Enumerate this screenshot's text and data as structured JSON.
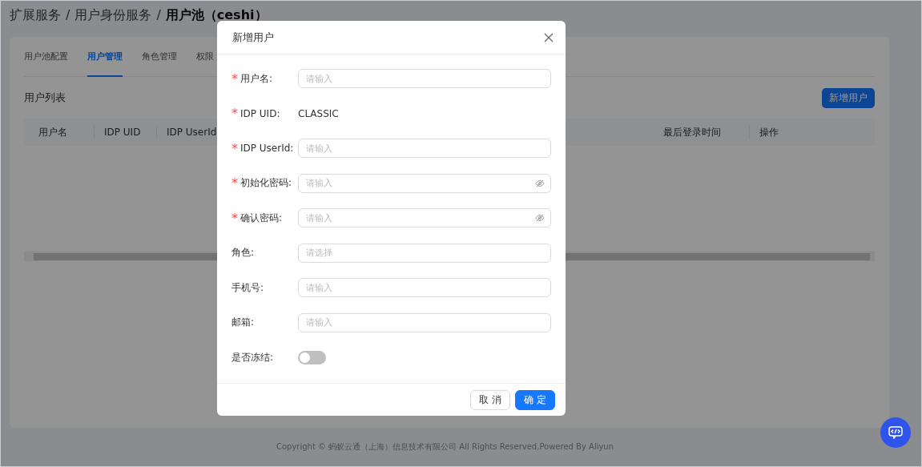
{
  "breadcrumb": [
    {
      "kind": "link",
      "label": "扩展服务"
    },
    {
      "kind": "separator",
      "label": "/"
    },
    {
      "kind": "link",
      "label": "用户身份服务"
    },
    {
      "kind": "separator",
      "label": "/"
    },
    {
      "kind": "current",
      "label": "用户池（ceshi）"
    }
  ],
  "tabs": [
    {
      "label": "用户池配置",
      "selected": false
    },
    {
      "label": "用户管理",
      "selected": true
    },
    {
      "label": "角色管理",
      "selected": false
    },
    {
      "label": "权限",
      "selected": false
    }
  ],
  "list_title": "用户列表",
  "add_button": "新增用户",
  "table": {
    "columns": [
      "用户名",
      "IDP UID",
      "IDP UserId",
      "最后登录时间",
      "操作"
    ]
  },
  "footer": "Copyright © 蚂蚁云通（上海）信息技术有限公司 All Rights Reserved,Powered By Aliyun",
  "dialog": {
    "title": "新增用户",
    "fields": [
      {
        "kind": "input",
        "label": "用户名:",
        "required_mark": "*",
        "placeholder": "请输入"
      },
      {
        "kind": "text",
        "label": "IDP UID:",
        "required_mark": "*",
        "value": "CLASSIC"
      },
      {
        "kind": "input",
        "label": "IDP UserId:",
        "required_mark": "*",
        "placeholder": "请输入"
      },
      {
        "kind": "password",
        "label": "初始化密码:",
        "required_mark": "*",
        "placeholder": "请输入"
      },
      {
        "kind": "password",
        "label": "确认密码:",
        "required_mark": "*",
        "placeholder": "请输入"
      },
      {
        "kind": "select",
        "label": "角色:",
        "placeholder": "请选择"
      },
      {
        "kind": "input",
        "label": "手机号:",
        "placeholder": "请输入"
      },
      {
        "kind": "input",
        "label": "邮箱:",
        "placeholder": "请输入"
      },
      {
        "kind": "switch",
        "label": "是否冻结:",
        "on": false
      }
    ],
    "buttons": [
      {
        "label": "取 消",
        "primary": false
      },
      {
        "label": "确 定",
        "primary": true
      }
    ]
  }
}
